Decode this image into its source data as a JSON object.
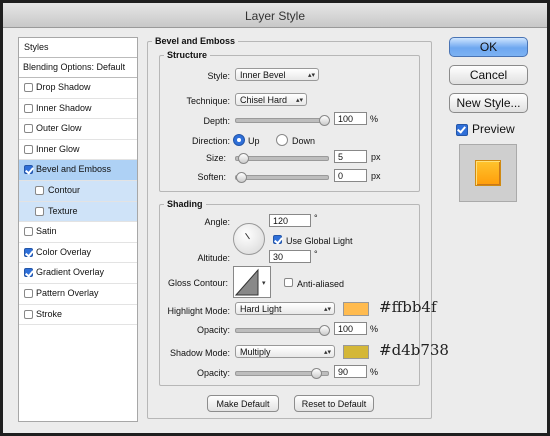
{
  "window": {
    "title": "Layer Style"
  },
  "sidebar": {
    "header": "Styles",
    "blending": "Blending Options: Default",
    "items": [
      {
        "label": "Drop Shadow",
        "checked": false
      },
      {
        "label": "Inner Shadow",
        "checked": false
      },
      {
        "label": "Outer Glow",
        "checked": false
      },
      {
        "label": "Inner Glow",
        "checked": false
      },
      {
        "label": "Bevel and Emboss",
        "checked": true
      },
      {
        "label": "Contour",
        "checked": false
      },
      {
        "label": "Texture",
        "checked": false
      },
      {
        "label": "Satin",
        "checked": false
      },
      {
        "label": "Color Overlay",
        "checked": true
      },
      {
        "label": "Gradient Overlay",
        "checked": true
      },
      {
        "label": "Pattern Overlay",
        "checked": false
      },
      {
        "label": "Stroke",
        "checked": false
      }
    ]
  },
  "bevel": {
    "title": "Bevel and Emboss",
    "structure": {
      "title": "Structure",
      "style_label": "Style:",
      "style_value": "Inner Bevel",
      "technique_label": "Technique:",
      "technique_value": "Chisel Hard",
      "depth_label": "Depth:",
      "depth_value": "100",
      "depth_unit": "%",
      "depth_level": 1.0,
      "direction_label": "Direction:",
      "dir_up": "Up",
      "dir_down": "Down",
      "size_label": "Size:",
      "size_value": "5",
      "size_unit": "px",
      "size_level": 0.02,
      "soften_label": "Soften:",
      "soften_value": "0",
      "soften_unit": "px",
      "soften_level": 0.0
    },
    "shading": {
      "title": "Shading",
      "angle_label": "Angle:",
      "angle_value": "120",
      "angle_unit": "°",
      "global_light": "Use Global Light",
      "altitude_label": "Altitude:",
      "altitude_value": "30",
      "altitude_unit": "°",
      "gloss_label": "Gloss Contour:",
      "anti_aliased": "Anti-aliased",
      "highlight_label": "Highlight Mode:",
      "highlight_value": "Hard Light",
      "highlight_color": "#ffbb4f",
      "highlight_hex": "#ffbb4f",
      "hl_opacity_label": "Opacity:",
      "hl_opacity_value": "100",
      "hl_opacity_unit": "%",
      "hl_opacity_level": 1.0,
      "shadow_label": "Shadow Mode:",
      "shadow_value": "Multiply",
      "shadow_color": "#d4b738",
      "shadow_hex": "#d4b738",
      "sh_opacity_label": "Opacity:",
      "sh_opacity_value": "90",
      "sh_opacity_unit": "%",
      "sh_opacity_level": 0.9
    },
    "make_default": "Make Default",
    "reset_default": "Reset to Default"
  },
  "actions": {
    "ok": "OK",
    "cancel": "Cancel",
    "new_style": "New Style...",
    "preview": "Preview"
  }
}
